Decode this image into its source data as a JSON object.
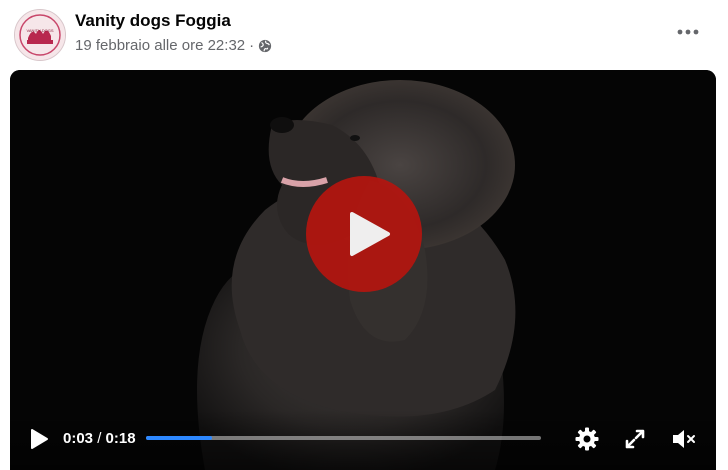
{
  "post": {
    "page_name": "Vanity dogs Foggia",
    "date": "19 febbraio alle ore 22:32",
    "separator": "·",
    "audience_icon": "globe-icon",
    "avatar_text": "VANITY DOGS"
  },
  "video": {
    "current_time": "0:03",
    "duration": "0:18",
    "time_separator": "/",
    "progress": 0.167,
    "play_button_color": "#b5150f",
    "progress_color": "#2d88ff",
    "icons": [
      "play-icon",
      "settings-gear-icon",
      "fullscreen-icon",
      "volume-muted-icon"
    ]
  }
}
